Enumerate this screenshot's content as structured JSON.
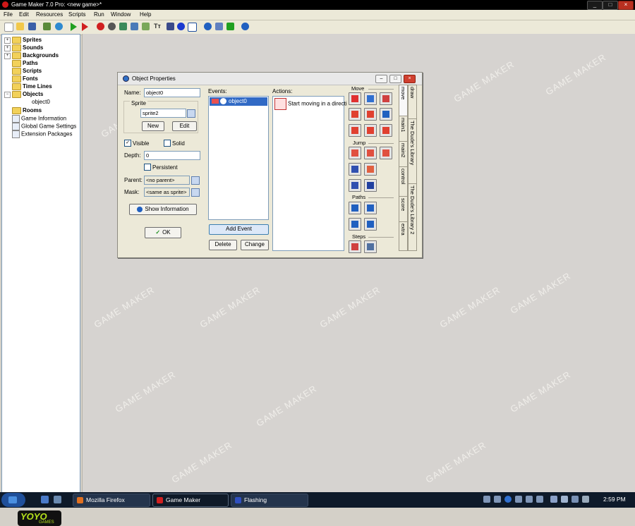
{
  "window": {
    "title": "Game Maker 7.0 Pro: <new game>*",
    "buttons": [
      "minimize",
      "maximize",
      "close"
    ]
  },
  "menu": [
    "File",
    "Edit",
    "Resources",
    "Scripts",
    "Run",
    "Window",
    "Help"
  ],
  "toolbar_icons": [
    "new-file-icon",
    "open-folder-icon",
    "save-icon",
    "publish-icon",
    "globe-icon",
    "run-icon",
    "debug-run-icon",
    "add-sprite-icon",
    "add-sound-icon",
    "add-background-icon",
    "add-path-icon",
    "add-script-icon",
    "add-font-icon",
    "add-timeline-icon",
    "add-object-icon",
    "add-room-icon",
    "game-information-icon",
    "global-settings-icon",
    "extension-packages-icon",
    "help-icon"
  ],
  "tree": {
    "items": [
      {
        "label": "Sprites",
        "bold": true,
        "folder": true
      },
      {
        "label": "Sounds",
        "bold": true,
        "folder": true
      },
      {
        "label": "Backgrounds",
        "bold": true,
        "folder": true
      },
      {
        "label": "Paths",
        "bold": true,
        "folder": true
      },
      {
        "label": "Scripts",
        "bold": true,
        "folder": true
      },
      {
        "label": "Fonts",
        "bold": true,
        "folder": true
      },
      {
        "label": "Time Lines",
        "bold": true,
        "folder": true
      },
      {
        "label": "Objects",
        "bold": true,
        "folder": true
      },
      {
        "label": "object0",
        "bold": false,
        "folder": false
      },
      {
        "label": "Rooms",
        "bold": true,
        "folder": true
      },
      {
        "label": "Game Information",
        "bold": false,
        "folder": false
      },
      {
        "label": "Global Game Settings",
        "bold": false,
        "folder": false
      },
      {
        "label": "Extension Packages",
        "bold": false,
        "folder": false
      }
    ]
  },
  "branding": {
    "logo_text": "YOYO",
    "logo_sub": "GAMES",
    "color": "#b6e21c"
  },
  "watermark": "GAME MAKER",
  "dialog": {
    "title": "Object Properties",
    "name_label": "Name:",
    "name_value": "object0",
    "sprite_label": "Sprite",
    "sprite_value": "sprite2",
    "new_button": "New",
    "edit_button": "Edit",
    "visible_label": "Visible",
    "visible_checked": true,
    "solid_label": "Solid",
    "solid_checked": false,
    "depth_label": "Depth:",
    "depth_value": "0",
    "persistent_label": "Persistent",
    "persistent_checked": false,
    "parent_label": "Parent:",
    "parent_value": "<no parent>",
    "mask_label": "Mask:",
    "mask_value": "<same as sprite>",
    "show_info_button": "Show Information",
    "ok_button": "OK",
    "events_label": "Events:",
    "events": [
      "object0"
    ],
    "actions_label": "Actions:",
    "actions": [
      "Start moving in a directi"
    ],
    "add_event_button": "Add Event",
    "delete_button": "Delete",
    "change_button": "Change",
    "palette": {
      "move_label": "Move",
      "jump_label": "Jump",
      "paths_label": "Paths",
      "steps_label": "Steps"
    },
    "tabs_left": [
      "move",
      "main1",
      "main2",
      "control",
      "score",
      "extra"
    ],
    "tabs_right": [
      "draw",
      "The Dude's Library",
      "The Dude's Library 2"
    ]
  },
  "taskbar": {
    "tasks": [
      {
        "label": "Mozilla Firefox",
        "active": false
      },
      {
        "label": "Game Maker",
        "active": true
      },
      {
        "label": "Flashing",
        "active": false
      }
    ],
    "clock": "2:59 PM"
  }
}
